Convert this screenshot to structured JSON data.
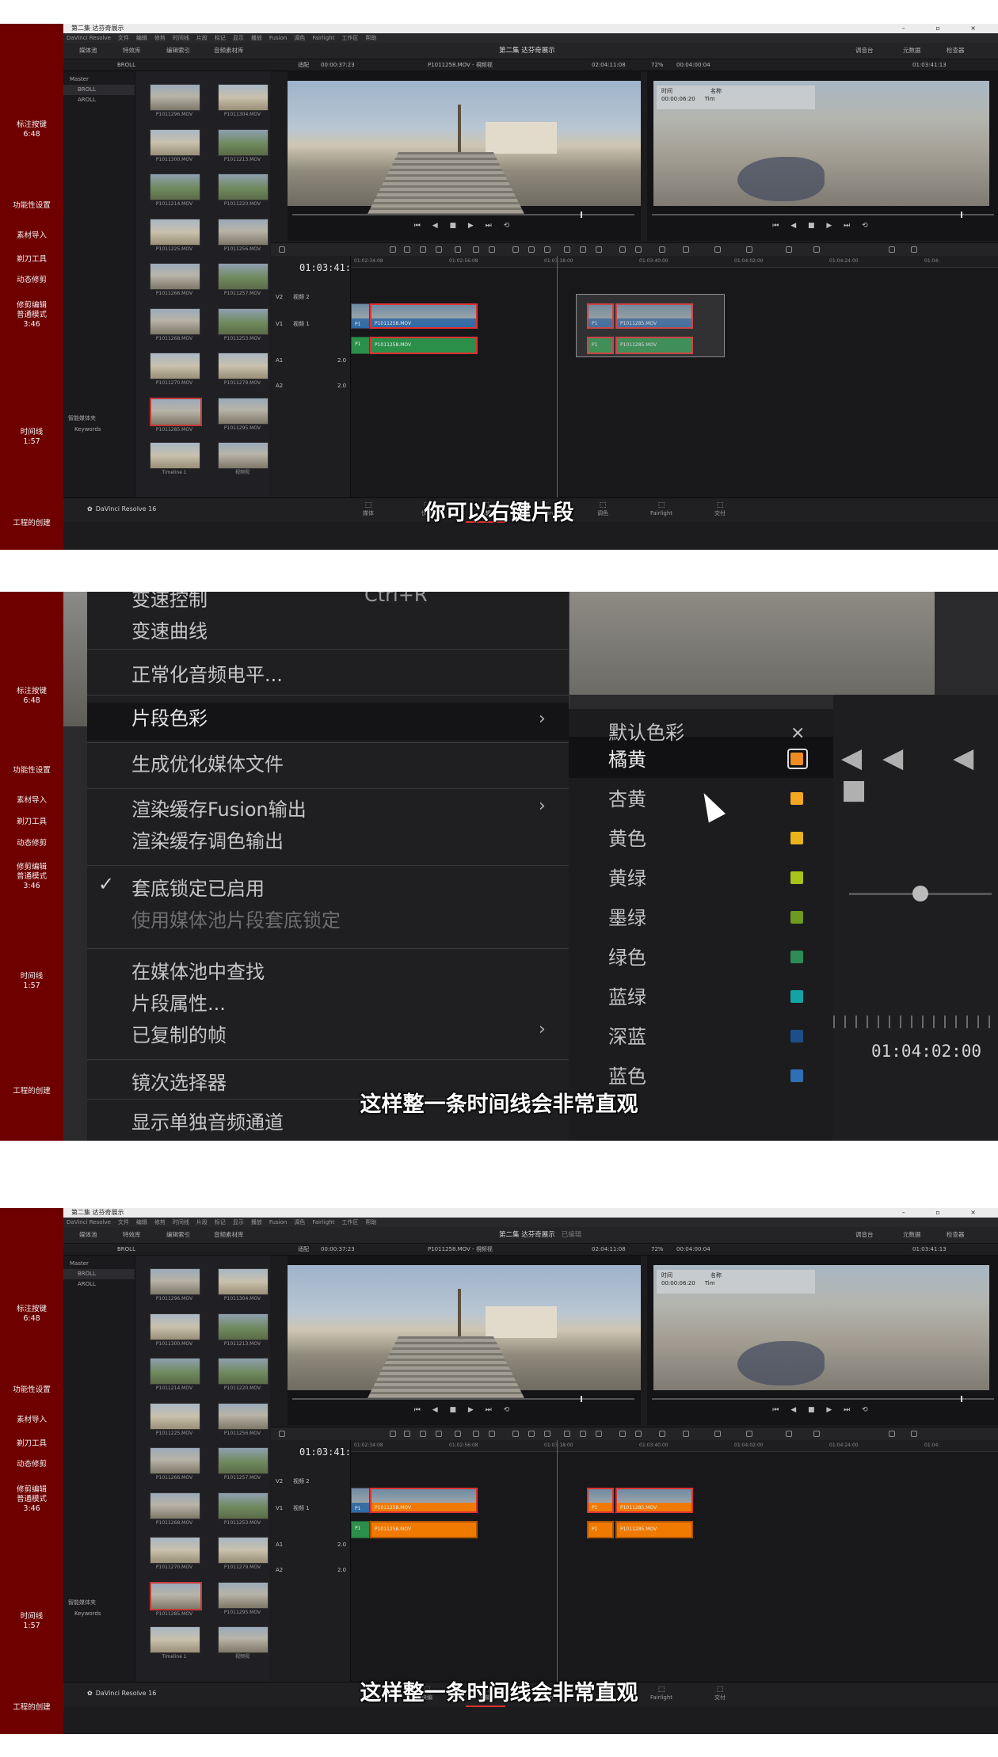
{
  "chapters": [
    {
      "label": "标注按键\n6:48",
      "top": 0
    },
    {
      "label": "功能性设置",
      "top": 0
    },
    {
      "label": "素材导入",
      "top": 0
    },
    {
      "label": "剃刀工具",
      "top": 0
    },
    {
      "label": "动态修剪",
      "top": 0
    },
    {
      "label": "修剪编辑\n普通模式\n3:46",
      "top": 0
    },
    {
      "label": "时间线\n1:57",
      "top": 0
    },
    {
      "label": "工程的创建",
      "top": 0
    }
  ],
  "resolve": {
    "window_title": "第二集 达芬奇展示",
    "window_controls": "–  ▫  ×",
    "menu": [
      "DaVinci Resolve",
      "文件",
      "编辑",
      "修剪",
      "时间线",
      "片段",
      "标记",
      "显示",
      "播放",
      "Fusion",
      "调色",
      "Fairlight",
      "工作区",
      "帮助"
    ],
    "toolbar": [
      "媒体池",
      "特效库",
      "编辑索引",
      "音频素材库"
    ],
    "toolbar_right": [
      "调音台",
      "元数据",
      "检查器"
    ],
    "project_title": "第二集 达芬奇展示",
    "project_status": "已编辑",
    "bin_name": "BROLL",
    "zoom_src": "适配",
    "src_timecode": "00:00:37:23",
    "clip_name": "P1011258.MOV - 視频视",
    "src_duration": "02:04:11:08",
    "zoom_rec": "72%",
    "rec_timecode": "00:04:00:04",
    "rec_tc_right": "01:03:41:13",
    "bins": [
      "Master",
      "BROLL",
      "AROLL"
    ],
    "smart_bins": "智能媒体夹",
    "keywords": "Keywords",
    "clips": [
      {
        "name": "P1011296.MOV",
        "tone": ""
      },
      {
        "name": "P1011304.MOV",
        "tone": "sand"
      },
      {
        "name": "P1011300.MOV",
        "tone": "sand"
      },
      {
        "name": "P1011213.MOV",
        "tone": "green"
      },
      {
        "name": "P1011214.MOV",
        "tone": "green"
      },
      {
        "name": "P1011220.MOV",
        "tone": "green"
      },
      {
        "name": "P1011225.MOV",
        "tone": "sand"
      },
      {
        "name": "P1011256.MOV",
        "tone": ""
      },
      {
        "name": "P1011266.MOV",
        "tone": ""
      },
      {
        "name": "P1011257.MOV",
        "tone": "green"
      },
      {
        "name": "P1011268.MOV",
        "tone": ""
      },
      {
        "name": "P1011253.MOV",
        "tone": "green"
      },
      {
        "name": "P1011270.MOV",
        "tone": "sand"
      },
      {
        "name": "P1011279.MOV",
        "tone": "sand"
      },
      {
        "name": "P1011285.MOV",
        "tone": "sel"
      },
      {
        "name": "P1011295.MOV",
        "tone": ""
      },
      {
        "name": "Timeline 1",
        "tone": "sand"
      },
      {
        "name": "视频视",
        "tone": ""
      }
    ],
    "overlay_labels": {
      "col1": "时间",
      "col2": "名称"
    },
    "overlay_values": {
      "col1": "00:00:06:20",
      "col2": "Tim"
    },
    "timeline_tc": "01:03:41:13",
    "tracks": {
      "v2": "V2",
      "v2_name": "视频 2",
      "v1": "V1",
      "v1_name": "视频 1",
      "a1": "A1",
      "a2": "A2",
      "gain": "2.0"
    },
    "ruler": [
      "01:02:34:08",
      "01:02:56:08",
      "01:03:18:00",
      "01:03:40:00",
      "01:04:02:00",
      "01:04:24:00",
      "01:04:"
    ],
    "clip_label_a": "P1011258.MOV",
    "clip_label_b": "P1011285.MOV",
    "clip_label_short": "P1",
    "pages": [
      "媒体",
      "快编",
      "剪辑",
      "Fusion",
      "调色",
      "Fairlight",
      "交付"
    ],
    "product": "DaVinci Resolve 16"
  },
  "subtitles": {
    "p1": "你可以右键片段",
    "p2": "这样整一条时间线会非常直观",
    "p3": "这样整一条时间线会非常直观"
  },
  "context_menu": {
    "items": [
      {
        "label": "变速控制",
        "state": "normal"
      },
      {
        "label": "变速曲线",
        "state": "normal"
      },
      {
        "label": "正常化音频电平...",
        "state": "normal"
      },
      {
        "label": "片段色彩",
        "state": "highlight"
      },
      {
        "label": "生成优化媒体文件",
        "state": "normal"
      },
      {
        "label": "渲染缓存Fusion输出",
        "state": "normal"
      },
      {
        "label": "渲染缓存调色输出",
        "state": "normal"
      },
      {
        "label": "套底锁定已启用",
        "state": "checked"
      },
      {
        "label": "使用媒体池片段套底锁定",
        "state": "disabled"
      },
      {
        "label": "在媒体池中查找",
        "state": "normal"
      },
      {
        "label": "片段属性...",
        "state": "normal"
      },
      {
        "label": "已复制的帧",
        "state": "normal"
      },
      {
        "label": "镜次选择器",
        "state": "normal"
      },
      {
        "label": "显示单独音频通道",
        "state": "normal"
      }
    ],
    "shortcut": "Ctrl+R"
  },
  "clip_color_menu": {
    "default_label": "默认色彩",
    "close": "×",
    "colors": [
      {
        "label": "橘黄",
        "hex": "#f08c20"
      },
      {
        "label": "杏黄",
        "hex": "#f5a623"
      },
      {
        "label": "黄色",
        "hex": "#e8b41c"
      },
      {
        "label": "黄绿",
        "hex": "#a8c41a"
      },
      {
        "label": "墨绿",
        "hex": "#6e9a22"
      },
      {
        "label": "绿色",
        "hex": "#2e8b57"
      },
      {
        "label": "蓝绿",
        "hex": "#14a3a3"
      },
      {
        "label": "深蓝",
        "hex": "#1b4f8a"
      },
      {
        "label": "蓝色",
        "hex": "#2f6fb5"
      }
    ],
    "hovered": "橘黄"
  },
  "zoom_right": {
    "timecode": "01:04:02:00"
  },
  "colors": {
    "sidebar": "#6e0000",
    "playhead": "#e03030",
    "video_clip": "#2f6aa8",
    "audio_clip": "#2b8f4a",
    "orange_clip": "#f07a00",
    "selection_red": "#d33333"
  }
}
